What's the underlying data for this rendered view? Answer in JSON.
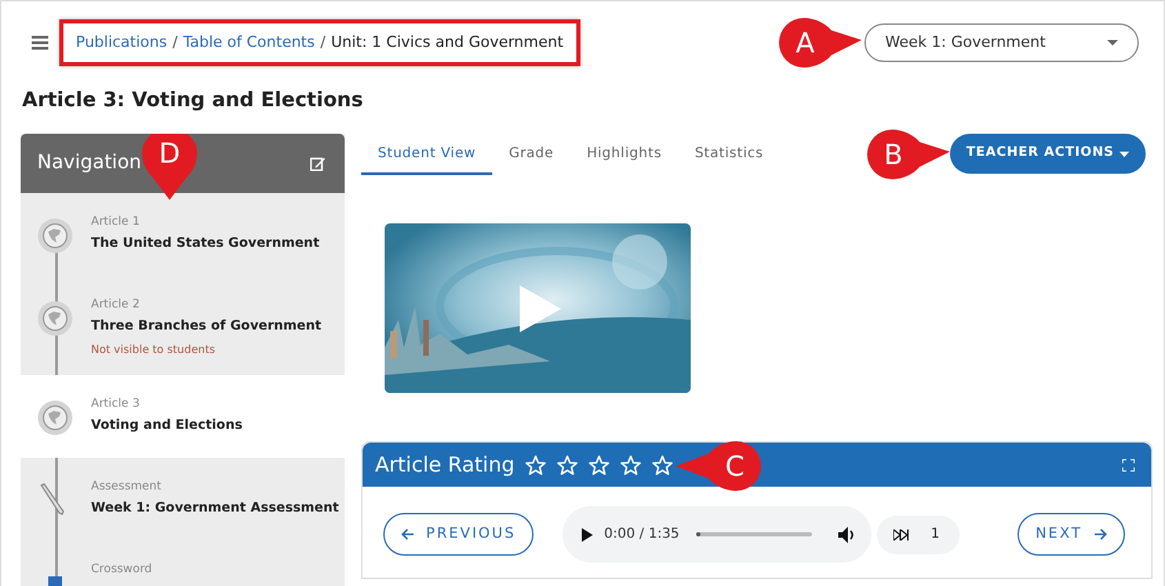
{
  "breadcrumb": {
    "highlighted": true,
    "separator": "/",
    "items": [
      {
        "label": "Publications",
        "link": true
      },
      {
        "label": "Table of Contents",
        "link": true
      },
      {
        "label": "Unit: 1 Civics and Government",
        "link": false
      }
    ]
  },
  "week_select": {
    "value": "Week 1: Government",
    "callout": "A"
  },
  "title": "Article 3: Voting and Elections",
  "navigation": {
    "title": "Navigation",
    "callout": "D",
    "items": [
      {
        "kind": "article",
        "type": "Article 1",
        "title": "The United States Government",
        "selected": false
      },
      {
        "kind": "article",
        "type": "Article 2",
        "title": "Three Branches of Government",
        "note": "Not visible to students",
        "selected": false
      },
      {
        "kind": "article",
        "type": "Article 3",
        "title": "Voting and Elections",
        "selected": true
      },
      {
        "kind": "assessment",
        "type": "Assessment",
        "title": "Week 1: Government Assessment",
        "selected": false
      },
      {
        "kind": "crossword",
        "type": "Crossword",
        "selected": false
      }
    ]
  },
  "tabs": [
    {
      "label": "Student View",
      "selected": true
    },
    {
      "label": "Grade",
      "selected": false
    },
    {
      "label": "Highlights",
      "selected": false
    },
    {
      "label": "Statistics",
      "selected": false
    }
  ],
  "teacher_actions": {
    "label": "TEACHER ACTIONS",
    "callout": "B"
  },
  "rating": {
    "title": "Article Rating",
    "stars": 0,
    "callout": "C"
  },
  "audio": {
    "time": "0:00 / 1:35",
    "level": 0,
    "speed": "1"
  },
  "buttons": {
    "previous": "PREVIOUS",
    "next": "NEXT"
  }
}
